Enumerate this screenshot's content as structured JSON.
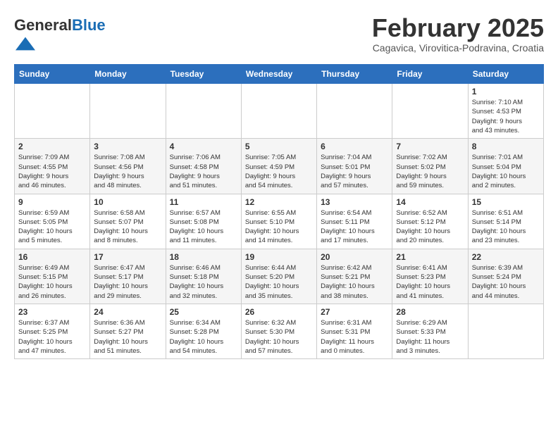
{
  "logo": {
    "general": "General",
    "blue": "Blue"
  },
  "header": {
    "title": "February 2025",
    "subtitle": "Cagavica, Virovitica-Podravina, Croatia"
  },
  "weekdays": [
    "Sunday",
    "Monday",
    "Tuesday",
    "Wednesday",
    "Thursday",
    "Friday",
    "Saturday"
  ],
  "weeks": [
    [
      {
        "day": "",
        "info": ""
      },
      {
        "day": "",
        "info": ""
      },
      {
        "day": "",
        "info": ""
      },
      {
        "day": "",
        "info": ""
      },
      {
        "day": "",
        "info": ""
      },
      {
        "day": "",
        "info": ""
      },
      {
        "day": "1",
        "info": "Sunrise: 7:10 AM\nSunset: 4:53 PM\nDaylight: 9 hours\nand 43 minutes."
      }
    ],
    [
      {
        "day": "2",
        "info": "Sunrise: 7:09 AM\nSunset: 4:55 PM\nDaylight: 9 hours\nand 46 minutes."
      },
      {
        "day": "3",
        "info": "Sunrise: 7:08 AM\nSunset: 4:56 PM\nDaylight: 9 hours\nand 48 minutes."
      },
      {
        "day": "4",
        "info": "Sunrise: 7:06 AM\nSunset: 4:58 PM\nDaylight: 9 hours\nand 51 minutes."
      },
      {
        "day": "5",
        "info": "Sunrise: 7:05 AM\nSunset: 4:59 PM\nDaylight: 9 hours\nand 54 minutes."
      },
      {
        "day": "6",
        "info": "Sunrise: 7:04 AM\nSunset: 5:01 PM\nDaylight: 9 hours\nand 57 minutes."
      },
      {
        "day": "7",
        "info": "Sunrise: 7:02 AM\nSunset: 5:02 PM\nDaylight: 9 hours\nand 59 minutes."
      },
      {
        "day": "8",
        "info": "Sunrise: 7:01 AM\nSunset: 5:04 PM\nDaylight: 10 hours\nand 2 minutes."
      }
    ],
    [
      {
        "day": "9",
        "info": "Sunrise: 6:59 AM\nSunset: 5:05 PM\nDaylight: 10 hours\nand 5 minutes."
      },
      {
        "day": "10",
        "info": "Sunrise: 6:58 AM\nSunset: 5:07 PM\nDaylight: 10 hours\nand 8 minutes."
      },
      {
        "day": "11",
        "info": "Sunrise: 6:57 AM\nSunset: 5:08 PM\nDaylight: 10 hours\nand 11 minutes."
      },
      {
        "day": "12",
        "info": "Sunrise: 6:55 AM\nSunset: 5:10 PM\nDaylight: 10 hours\nand 14 minutes."
      },
      {
        "day": "13",
        "info": "Sunrise: 6:54 AM\nSunset: 5:11 PM\nDaylight: 10 hours\nand 17 minutes."
      },
      {
        "day": "14",
        "info": "Sunrise: 6:52 AM\nSunset: 5:12 PM\nDaylight: 10 hours\nand 20 minutes."
      },
      {
        "day": "15",
        "info": "Sunrise: 6:51 AM\nSunset: 5:14 PM\nDaylight: 10 hours\nand 23 minutes."
      }
    ],
    [
      {
        "day": "16",
        "info": "Sunrise: 6:49 AM\nSunset: 5:15 PM\nDaylight: 10 hours\nand 26 minutes."
      },
      {
        "day": "17",
        "info": "Sunrise: 6:47 AM\nSunset: 5:17 PM\nDaylight: 10 hours\nand 29 minutes."
      },
      {
        "day": "18",
        "info": "Sunrise: 6:46 AM\nSunset: 5:18 PM\nDaylight: 10 hours\nand 32 minutes."
      },
      {
        "day": "19",
        "info": "Sunrise: 6:44 AM\nSunset: 5:20 PM\nDaylight: 10 hours\nand 35 minutes."
      },
      {
        "day": "20",
        "info": "Sunrise: 6:42 AM\nSunset: 5:21 PM\nDaylight: 10 hours\nand 38 minutes."
      },
      {
        "day": "21",
        "info": "Sunrise: 6:41 AM\nSunset: 5:23 PM\nDaylight: 10 hours\nand 41 minutes."
      },
      {
        "day": "22",
        "info": "Sunrise: 6:39 AM\nSunset: 5:24 PM\nDaylight: 10 hours\nand 44 minutes."
      }
    ],
    [
      {
        "day": "23",
        "info": "Sunrise: 6:37 AM\nSunset: 5:25 PM\nDaylight: 10 hours\nand 47 minutes."
      },
      {
        "day": "24",
        "info": "Sunrise: 6:36 AM\nSunset: 5:27 PM\nDaylight: 10 hours\nand 51 minutes."
      },
      {
        "day": "25",
        "info": "Sunrise: 6:34 AM\nSunset: 5:28 PM\nDaylight: 10 hours\nand 54 minutes."
      },
      {
        "day": "26",
        "info": "Sunrise: 6:32 AM\nSunset: 5:30 PM\nDaylight: 10 hours\nand 57 minutes."
      },
      {
        "day": "27",
        "info": "Sunrise: 6:31 AM\nSunset: 5:31 PM\nDaylight: 11 hours\nand 0 minutes."
      },
      {
        "day": "28",
        "info": "Sunrise: 6:29 AM\nSunset: 5:33 PM\nDaylight: 11 hours\nand 3 minutes."
      },
      {
        "day": "",
        "info": ""
      }
    ]
  ]
}
